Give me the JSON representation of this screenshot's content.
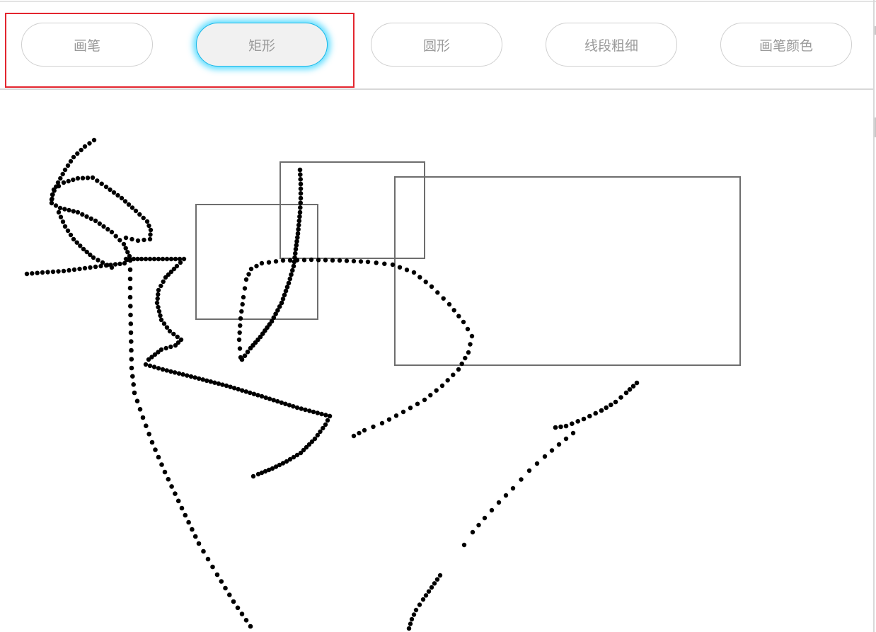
{
  "toolbar": {
    "buttons": [
      {
        "label": "画笔",
        "active": false
      },
      {
        "label": "矩形",
        "active": true
      },
      {
        "label": "圆形",
        "active": false
      },
      {
        "label": "线段粗细",
        "active": false
      },
      {
        "label": "画笔颜色",
        "active": false
      }
    ]
  },
  "colors": {
    "active_glow": "#28d2ff",
    "highlight_border": "#e3262f",
    "stroke": "#000000",
    "rect_stroke": "#6e6e6e"
  }
}
